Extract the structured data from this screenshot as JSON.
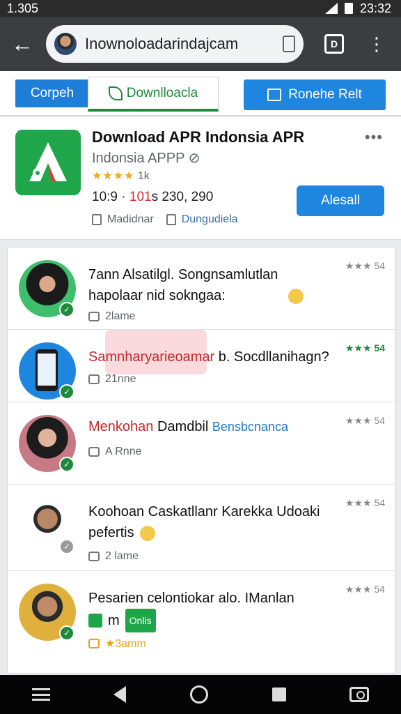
{
  "statusbar": {
    "left_text": "1.305",
    "time": "23:32"
  },
  "browser": {
    "url": "Inownoloadarindajcam",
    "tab_count": "D"
  },
  "tabs": {
    "tab1": "Corpeh",
    "tab2": "Downlloacla",
    "tab3": "Ronehe Relt"
  },
  "app": {
    "title": "Download APR Indonsia APR",
    "developer": "Indonsia APPP",
    "rating_stars": "★★★★",
    "rating_count": "1k",
    "stats_a": "10:9 ·",
    "stats_red": "101",
    "stats_b": "s 230, 290",
    "link1": "Madidnar",
    "link2": "Dungudiela",
    "install_label": "Alesall",
    "more": "•••"
  },
  "reviews": [
    {
      "text1": "7ann Alsatilgl. Songnsamlutlan",
      "text2": "hapolaar nid sokngaa:",
      "stars": "★★★ 54",
      "meta": "2lame"
    },
    {
      "text_red": "Samnharyarieoamar",
      "text_rest": " b. Socdllanihagn?",
      "stars": "★★★ 54",
      "meta": "21nne"
    },
    {
      "text_red": "Menkohan",
      "text_mid": " Damdbil ",
      "text_blue": "Bensbcnanca",
      "stars": "★★★ 54",
      "meta": "A Rnne"
    },
    {
      "text1": "Koohoan Caskatllanr Karekka Udoaki",
      "text2": "pefertis",
      "stars": "★★★ 54",
      "meta": "2 lame"
    },
    {
      "text1": "Pesarien celontiokar alo. IManlan",
      "pill": "Onlis",
      "pill_prefix": "m",
      "stars": "★★★ 54",
      "meta": "★3amm"
    }
  ]
}
